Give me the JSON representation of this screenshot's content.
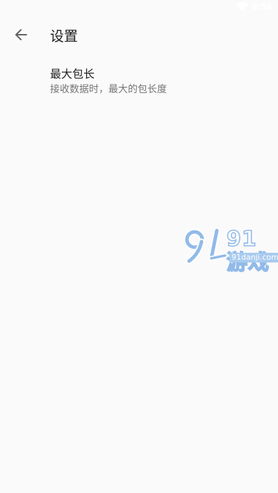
{
  "status_bar": {
    "time": "9:58",
    "wifi_icon": "wifi-icon"
  },
  "toolbar": {
    "back_icon": "arrow-back-icon",
    "title": "设置"
  },
  "preferences": [
    {
      "title": "最大包长",
      "summary": "接收数据时，最大的包长度"
    }
  ],
  "watermark": {
    "logo_text": "91游戏",
    "site": "91danji.com"
  },
  "colors": {
    "background": "#fafafa",
    "title": "#212121",
    "summary": "#757575",
    "watermark_accent": "#7fb0e6"
  }
}
